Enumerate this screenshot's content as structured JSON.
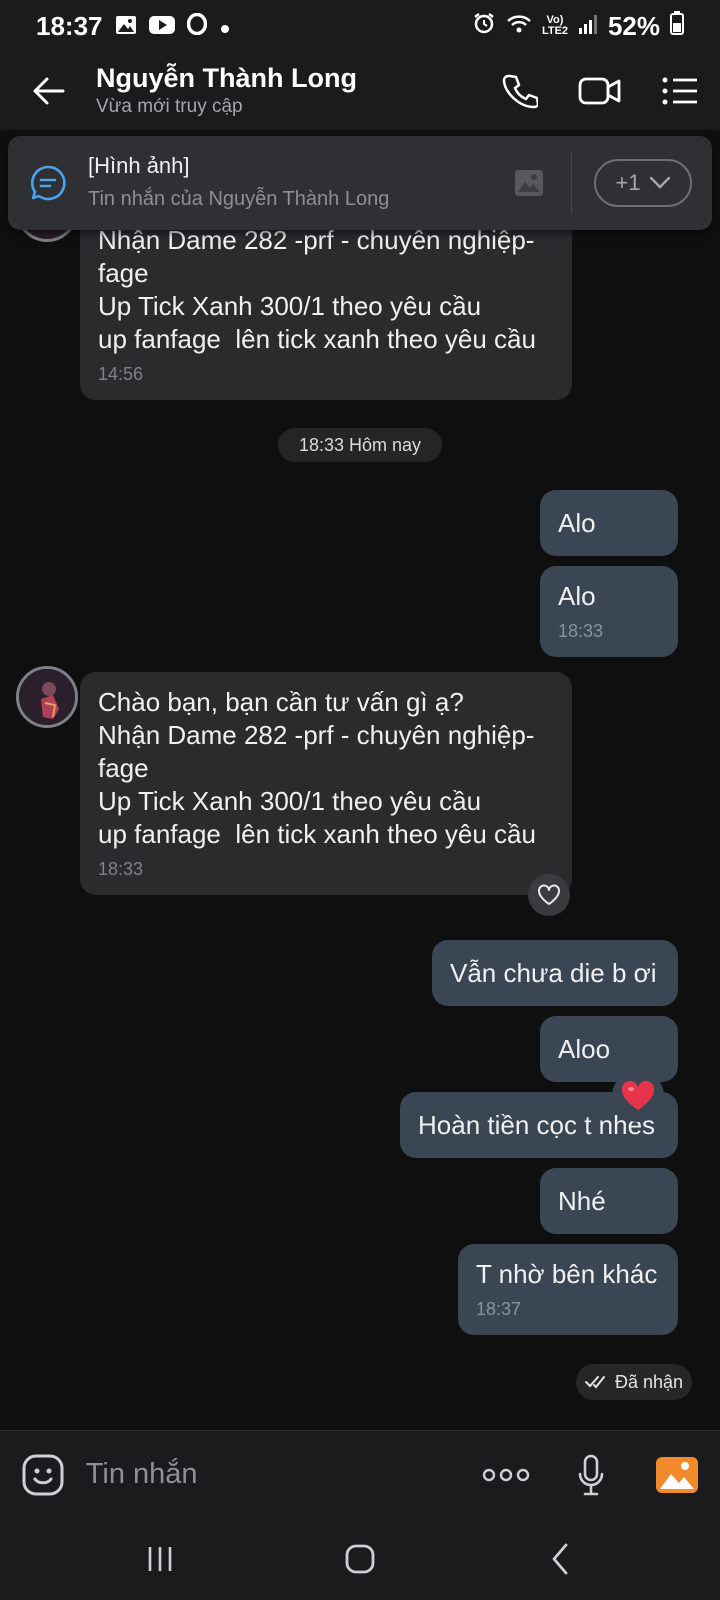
{
  "status_bar": {
    "time": "18:37",
    "battery": "52%",
    "network_label": "Vo) LTE2"
  },
  "header": {
    "contact_name": "Nguyễn Thành Long",
    "contact_status": "Vừa mới truy cập"
  },
  "pinned": {
    "title": "[Hình ảnh]",
    "subtitle": "Tin nhắn của Nguyễn Thành Long",
    "more_count": "+1"
  },
  "messages": [
    {
      "from": "contact",
      "lines": [
        "Nhận Dame 282 -prf - chuyên nghiệp-",
        "fage",
        "Up Tick Xanh 300/1 theo yêu cầu",
        "up fanfage  lên tick xanh theo yêu cầu"
      ],
      "time": "14:56"
    },
    {
      "date_separator": "18:33 Hôm nay"
    },
    {
      "from": "me",
      "text": "Alo"
    },
    {
      "from": "me",
      "text": "Alo",
      "time": "18:33"
    },
    {
      "from": "contact",
      "lines": [
        "Chào bạn, bạn cần tư vấn gì ạ?",
        "Nhận Dame 282 -prf - chuyên nghiệp-",
        "fage",
        "Up Tick Xanh 300/1 theo yêu cầu",
        "up fanfage  lên tick xanh theo yêu cầu"
      ],
      "time": "18:33"
    },
    {
      "from": "me",
      "text": "Vẫn chưa die b ơi"
    },
    {
      "from": "me",
      "text": "Aloo"
    },
    {
      "from": "me",
      "text": "Hoàn tiền cọc t nhés"
    },
    {
      "from": "me",
      "text": "Nhé"
    },
    {
      "from": "me",
      "text": "T nhờ bên khác",
      "time": "18:37"
    }
  ],
  "delivery_status": "Đã nhận",
  "composer": {
    "placeholder": "Tin nhắn"
  },
  "colors": {
    "background": "#0f0f10",
    "received_bubble": "#2b2b2e",
    "sent_bubble": "#3b4654",
    "accent_gallery": "#f08a2a",
    "pinned_icon": "#4aa3f0",
    "heart": "#e8344a"
  },
  "icons": [
    "back-arrow-icon",
    "phone-icon",
    "video-call-icon",
    "menu-list-icon",
    "chat-bubble-icon",
    "image-icon",
    "chevron-down-icon",
    "heart-outline-icon",
    "heart-icon",
    "double-check-icon",
    "emoji-icon",
    "more-dots-icon",
    "microphone-icon",
    "gallery-icon",
    "recents-icon",
    "home-icon",
    "nav-back-icon"
  ]
}
